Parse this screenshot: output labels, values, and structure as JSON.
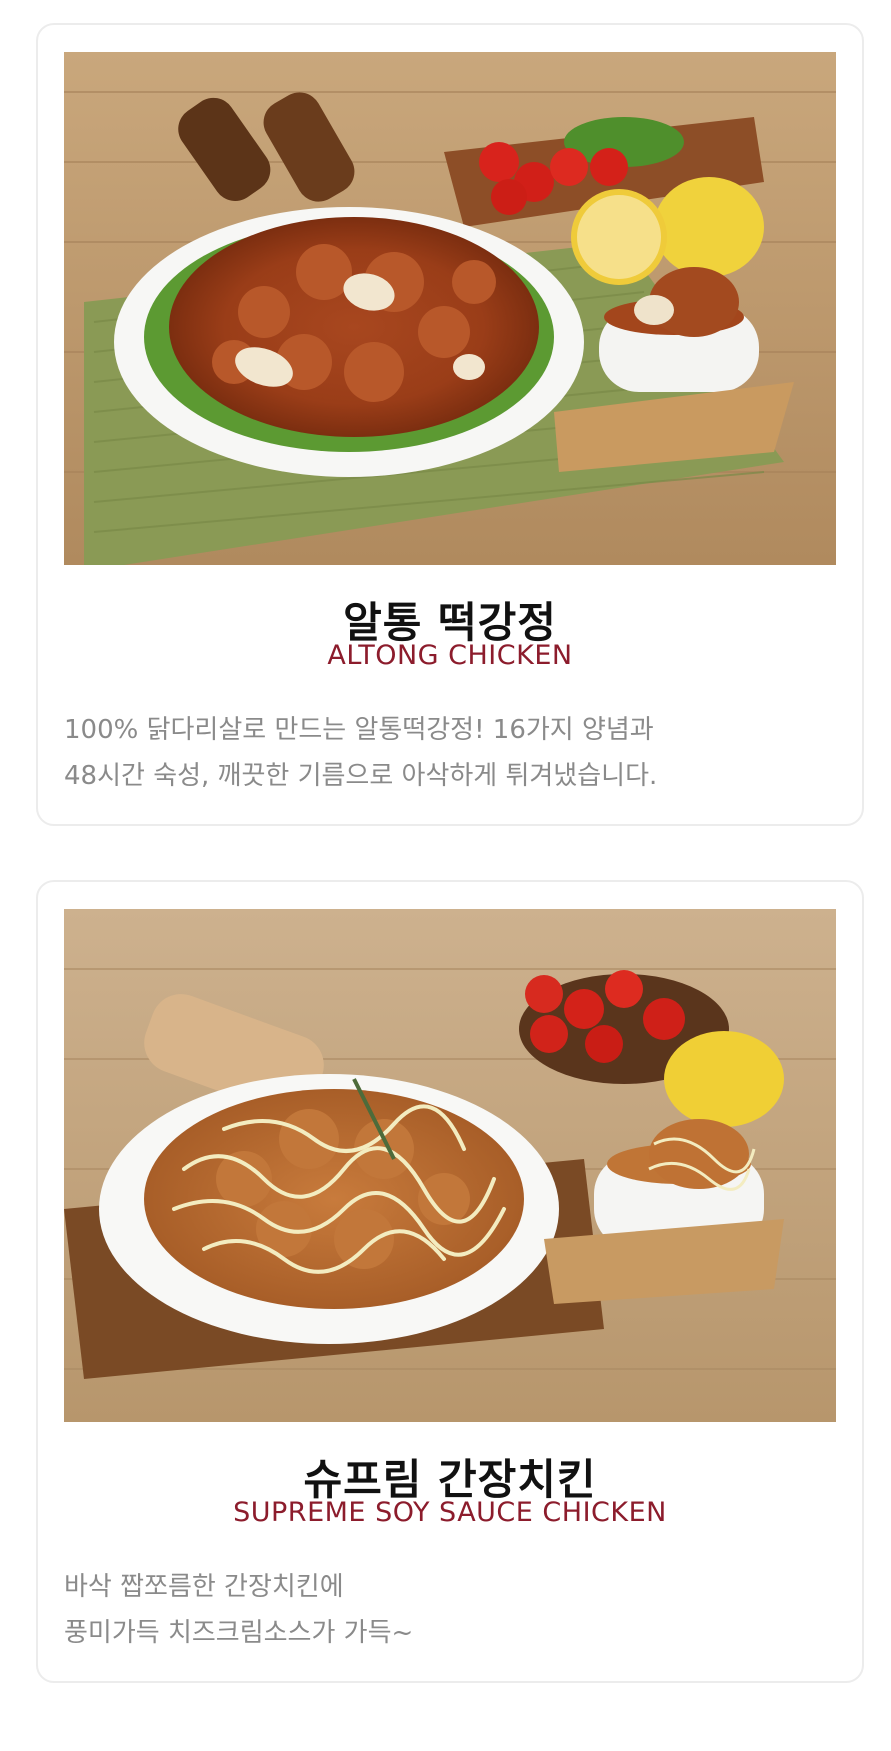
{
  "menu_items": [
    {
      "photo_icon": "fried-chicken-with-garlic-photo",
      "title": "알통 떡강정",
      "subtitle": "ALTONG CHICKEN",
      "description_lines": [
        "100% 닭다리살로 만드는 알통떡강정! 16가지 양념과",
        "48시간 숙성, 깨끗한 기름으로 아삭하게 튀겨냈습니다."
      ]
    },
    {
      "photo_icon": "soy-sauce-chicken-with-cream-sauce-photo",
      "title": "슈프림 간장치킨",
      "subtitle": "SUPREME SOY SAUCE CHICKEN",
      "description_lines": [
        "바삭 짭쪼름한 간장치킨에",
        "풍미가득 치즈크림소스가 가득~"
      ]
    }
  ],
  "colors": {
    "subtitle": "#8c1c2c",
    "title": "#111111",
    "description": "#8a8a8a",
    "card_border": "#ececec"
  }
}
